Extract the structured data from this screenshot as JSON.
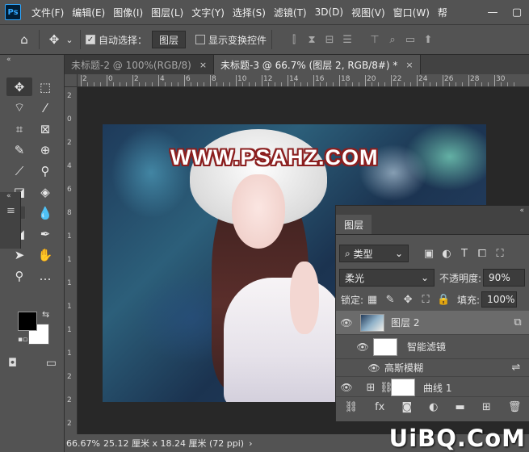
{
  "app": {
    "logo": "Ps"
  },
  "menu": [
    "文件(F)",
    "编辑(E)",
    "图像(I)",
    "图层(L)",
    "文字(Y)",
    "选择(S)",
    "滤镜(T)",
    "3D(D)",
    "视图(V)",
    "窗口(W)",
    "帮"
  ],
  "window_controls": {
    "minimize": "—",
    "maximize": "▢"
  },
  "options": {
    "home_icon": "⌂",
    "move_icon": "✥",
    "dropdown_caret": "⌄",
    "auto_select_label": "自动选择：",
    "auto_select_checked": "✓",
    "auto_select_target": "图层",
    "show_transform_label": "显示变换控件",
    "align_icons": [
      "⫿",
      "⧗",
      "⊟",
      "☰"
    ],
    "right_icons": [
      "⊤",
      "⌕",
      "▭",
      "⬆"
    ]
  },
  "toolbar": {
    "collapse": "«",
    "tools": [
      "✥",
      "⬚",
      "⌔",
      "⁄",
      "⌗",
      "⊠",
      "✎",
      "⊕",
      "⟋",
      "⚲",
      "◪",
      "◈",
      "⬛",
      "💧",
      "◢",
      "✒",
      "➤",
      "✋",
      "⚲",
      "…"
    ],
    "swap_icon": "⇆",
    "default_icon": "▪▫",
    "bottom_icons": [
      "◘",
      "▭"
    ],
    "foreground_color": "#000000",
    "background_color": "#ffffff"
  },
  "side_strip": {
    "collapse": "«",
    "menu": "≡"
  },
  "tabs": [
    {
      "label": "未标题-2 @ 100%(RGB/8)",
      "close": "×",
      "active": false
    },
    {
      "label": "未标题-3 @ 66.7% (图层 2, RGB/8#) *",
      "close": "×",
      "active": true
    }
  ],
  "ruler": {
    "h_labels": [
      "2",
      "0",
      "2",
      "4",
      "6",
      "8",
      "10",
      "12",
      "14",
      "16",
      "18",
      "20",
      "22",
      "24",
      "26",
      "28",
      "30"
    ],
    "v_labels": [
      "2",
      "0",
      "2",
      "4",
      "6",
      "8",
      "1",
      "1",
      "1",
      "1",
      "1",
      "1",
      "2",
      "2",
      "2"
    ]
  },
  "canvas": {
    "watermark": "WWW.PSAHZ.COM"
  },
  "layers_panel": {
    "dock": "«",
    "tab": "图层",
    "filter_kind": "类型",
    "filter_icons": [
      "▣",
      "◐",
      "T",
      "⧠",
      "⛶"
    ],
    "blend_mode": "柔光",
    "opacity_label": "不透明度:",
    "opacity_value": "90%",
    "lock_label": "锁定:",
    "lock_icons": [
      "▦",
      "✎",
      "✥",
      "⛶",
      "🔒"
    ],
    "fill_label": "填充:",
    "fill_value": "100%",
    "layers": [
      {
        "name": "图层 2",
        "eye": "👁",
        "selected": true,
        "badge": "⧉"
      },
      {
        "name": "智能滤镜",
        "eye": "👁",
        "selected": false
      },
      {
        "name": "高斯模糊",
        "eye": "👁",
        "selected": false,
        "badge": "⇌"
      },
      {
        "name": "曲线 1",
        "eye": "👁",
        "selected": false,
        "link": "⛓"
      }
    ],
    "footer_icons": [
      "⛓",
      "fx",
      "◙",
      "◐",
      "▬",
      "⊞",
      "🗑"
    ]
  },
  "status": {
    "zoom": "66.67%",
    "info": "25.12 厘米 x 18.24 厘米 (72 ppi)",
    "arrow": "›"
  },
  "site_watermark": "UiBQ.CoM"
}
